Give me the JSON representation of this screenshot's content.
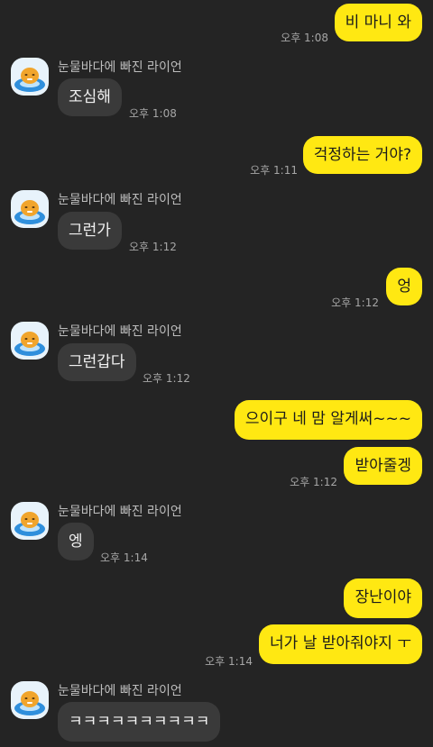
{
  "sender_name": "눈물바다에 빠진 라이언",
  "colors": {
    "background": "#242424",
    "my_bubble": "#FFE812",
    "their_bubble": "#3a3a3a"
  },
  "messages": [
    {
      "from": "me",
      "text": "비 마니 와",
      "time": "오후 1:08"
    },
    {
      "from": "them",
      "text": "조심해",
      "time": "오후 1:08"
    },
    {
      "from": "me",
      "text": "걱정하는 거야?",
      "time": "오후 1:11"
    },
    {
      "from": "them",
      "text": "그런가",
      "time": "오후 1:12"
    },
    {
      "from": "me",
      "text": "엉",
      "time": "오후 1:12"
    },
    {
      "from": "them",
      "text": "그런갑다",
      "time": "오후 1:12"
    },
    {
      "from": "me",
      "text": "으이구 네 맘 알게써~~~",
      "time": ""
    },
    {
      "from": "me",
      "text": "받아줄겡",
      "time": "오후 1:12"
    },
    {
      "from": "them",
      "text": "엥",
      "time": "오후 1:14"
    },
    {
      "from": "me",
      "text": "장난이야",
      "time": ""
    },
    {
      "from": "me",
      "text": "너가 날 받아줘야지 ㅜ",
      "time": "오후 1:14"
    },
    {
      "from": "them",
      "text": "ㅋㅋㅋㅋㅋㅋㅋㅋㅋㅋ",
      "time": ""
    }
  ]
}
